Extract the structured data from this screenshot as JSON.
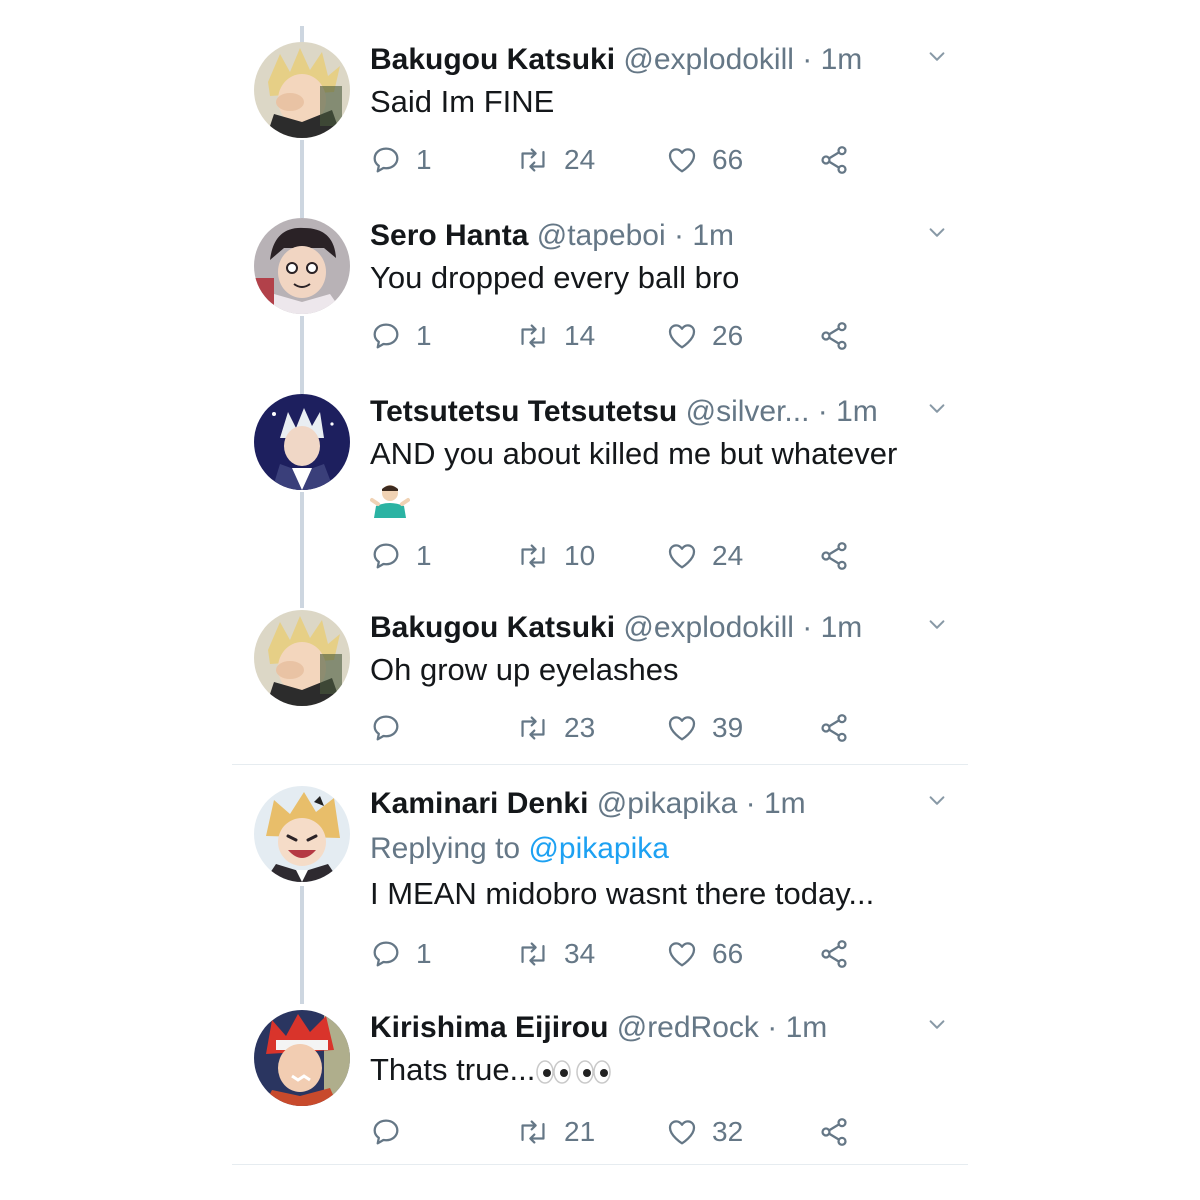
{
  "tweets": [
    {
      "name": "Bakugou Katsuki",
      "handle": "@explodokill",
      "dot": "·",
      "time": "1m",
      "text": "Said Im FINE",
      "replies": "1",
      "retweets": "24",
      "likes": "66"
    },
    {
      "name": "Sero Hanta",
      "handle": "@tapeboi",
      "dot": "·",
      "time": "1m",
      "text": "You dropped every ball bro",
      "replies": "1",
      "retweets": "14",
      "likes": "26"
    },
    {
      "name": "Tetsutetsu Tetsutetsu",
      "handle": "@silver...",
      "dot": "·",
      "time": "1m",
      "text": "AND you about killed me but whatever",
      "emoji": "man-shrugging-emoji",
      "replies": "1",
      "retweets": "10",
      "likes": "24"
    },
    {
      "name": "Bakugou Katsuki",
      "handle": "@explodokill",
      "dot": "·",
      "time": "1m",
      "text": "Oh grow up eyelashes",
      "replies": "",
      "retweets": "23",
      "likes": "39"
    },
    {
      "name": "Kaminari Denki",
      "handle": "@pikapika",
      "dot": "·",
      "time": "1m",
      "replying_label": "Replying to",
      "replying_handle": "@pikapika",
      "text": "I MEAN midobro wasnt there today...",
      "replies": "1",
      "retweets": "34",
      "likes": "66"
    },
    {
      "name": "Kirishima Eijirou",
      "handle": "@redRock",
      "dot": "·",
      "time": "1m",
      "text": "Thats true...",
      "emoji": "eyes-emoji",
      "replies": "",
      "retweets": "21",
      "likes": "32"
    }
  ],
  "icons": {
    "reply": "reply-icon",
    "retweet": "retweet-icon",
    "like": "heart-icon",
    "share": "share-icon",
    "menu": "chevron-down-icon"
  },
  "colors": {
    "text": "#14171a",
    "secondary": "#657786",
    "link": "#1da1f2",
    "thread_line": "#cdd6e0",
    "divider": "#e6ecf0"
  }
}
